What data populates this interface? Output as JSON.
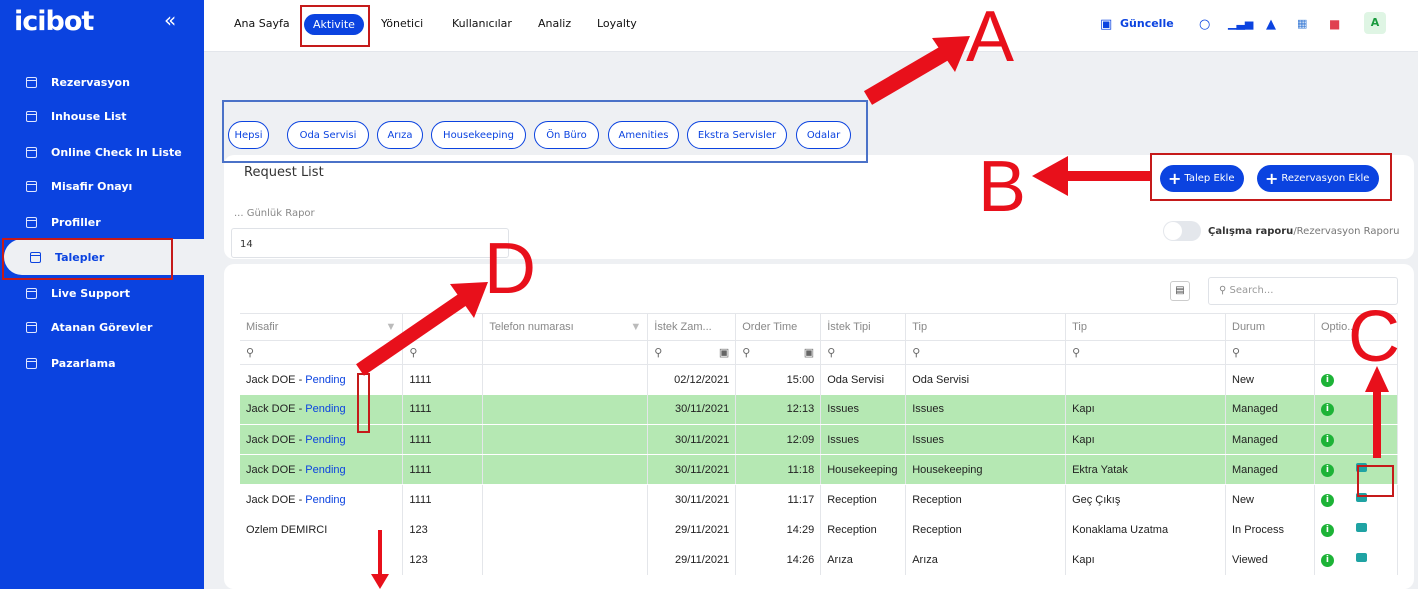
{
  "app": {
    "logo": "icibot",
    "collapse": "«"
  },
  "sidebar": {
    "items": [
      {
        "label": "Rezervasyon"
      },
      {
        "label": "Inhouse List"
      },
      {
        "label": "Online Check In Liste"
      },
      {
        "label": "Misafir Onayı"
      },
      {
        "label": "Profiller"
      },
      {
        "label": "Talepler"
      },
      {
        "label": "Live Support"
      },
      {
        "label": "Atanan Görevler"
      },
      {
        "label": "Pazarlama"
      }
    ]
  },
  "topnav": {
    "items": [
      {
        "label": "Ana Sayfa"
      },
      {
        "label": "Aktivite"
      },
      {
        "label": "Yönetici"
      },
      {
        "label": "Kullanıcılar"
      },
      {
        "label": "Analiz"
      },
      {
        "label": "Loyalty"
      }
    ],
    "update_label": "Güncelle",
    "avatar": "A"
  },
  "filters": {
    "chips": [
      {
        "label": "Hepsi"
      },
      {
        "label": "Oda Servisi"
      },
      {
        "label": "Arıza"
      },
      {
        "label": "Housekeeping"
      },
      {
        "label": "Ön Büro"
      },
      {
        "label": "Amenities"
      },
      {
        "label": "Ekstra Servisler"
      },
      {
        "label": "Odalar"
      }
    ]
  },
  "request_list": {
    "title": "Request List",
    "add_request": "Talep Ekle",
    "add_reservation": "Rezervasyon Ekle",
    "daily_report_label": "... Günlük Rapor",
    "daily_report_value": "14",
    "toggle_label_bold": "Çalışma raporu",
    "toggle_label_rest": "/Rezervasyon Raporu",
    "search_placeholder": "Search..."
  },
  "table": {
    "headers": [
      "Misafir",
      "...",
      "Telefon numarası",
      "İstek Zam...",
      "Order Time",
      "İstek Tipi",
      "Tip",
      "Tip",
      "Durum",
      "Optio..."
    ],
    "rows": [
      {
        "guest": "Jack DOE",
        "status_link": "Pending",
        "room": "1111",
        "phone": "",
        "date": "02/12/2021",
        "time": "15:00",
        "type": "Oda Servisi",
        "tip": "Oda Servisi",
        "tip2": "",
        "durum": "New"
      },
      {
        "guest": "Jack DOE",
        "status_link": "Pending",
        "room": "1111",
        "phone": "",
        "date": "30/11/2021",
        "time": "12:13",
        "type": "Issues",
        "tip": "Issues",
        "tip2": "Kapı",
        "durum": "Managed"
      },
      {
        "guest": "Jack DOE",
        "status_link": "Pending",
        "room": "1111",
        "phone": "",
        "date": "30/11/2021",
        "time": "12:09",
        "type": "Issues",
        "tip": "Issues",
        "tip2": "Kapı",
        "durum": "Managed"
      },
      {
        "guest": "Jack DOE",
        "status_link": "Pending",
        "room": "1111",
        "phone": "",
        "date": "30/11/2021",
        "time": "11:18",
        "type": "Housekeeping",
        "tip": "Housekeeping",
        "tip2": "Ektra Yatak",
        "durum": "Managed"
      },
      {
        "guest": "Jack DOE",
        "status_link": "Pending",
        "room": "1111",
        "phone": "",
        "date": "30/11/2021",
        "time": "11:17",
        "type": "Reception",
        "tip": "Reception",
        "tip2": "Geç Çıkış",
        "durum": "New"
      },
      {
        "guest": "Ozlem DEMIRCI",
        "status_link": "",
        "room": "123",
        "phone": "",
        "date": "29/11/2021",
        "time": "14:29",
        "type": "Reception",
        "tip": "Reception",
        "tip2": "Konaklama Uzatma",
        "durum": "In Process"
      },
      {
        "guest": "",
        "status_link": "",
        "room": "123",
        "phone": "",
        "date": "29/11/2021",
        "time": "14:26",
        "type": "Arıza",
        "tip": "Arıza",
        "tip2": "Kapı",
        "durum": "Viewed"
      }
    ]
  },
  "annotations": {
    "a": "A",
    "b": "B",
    "c": "C",
    "d": "D"
  },
  "colors": {
    "brand": "#0b43e0",
    "annotation": "#e8101b",
    "row_green": "#b5e8b3"
  }
}
